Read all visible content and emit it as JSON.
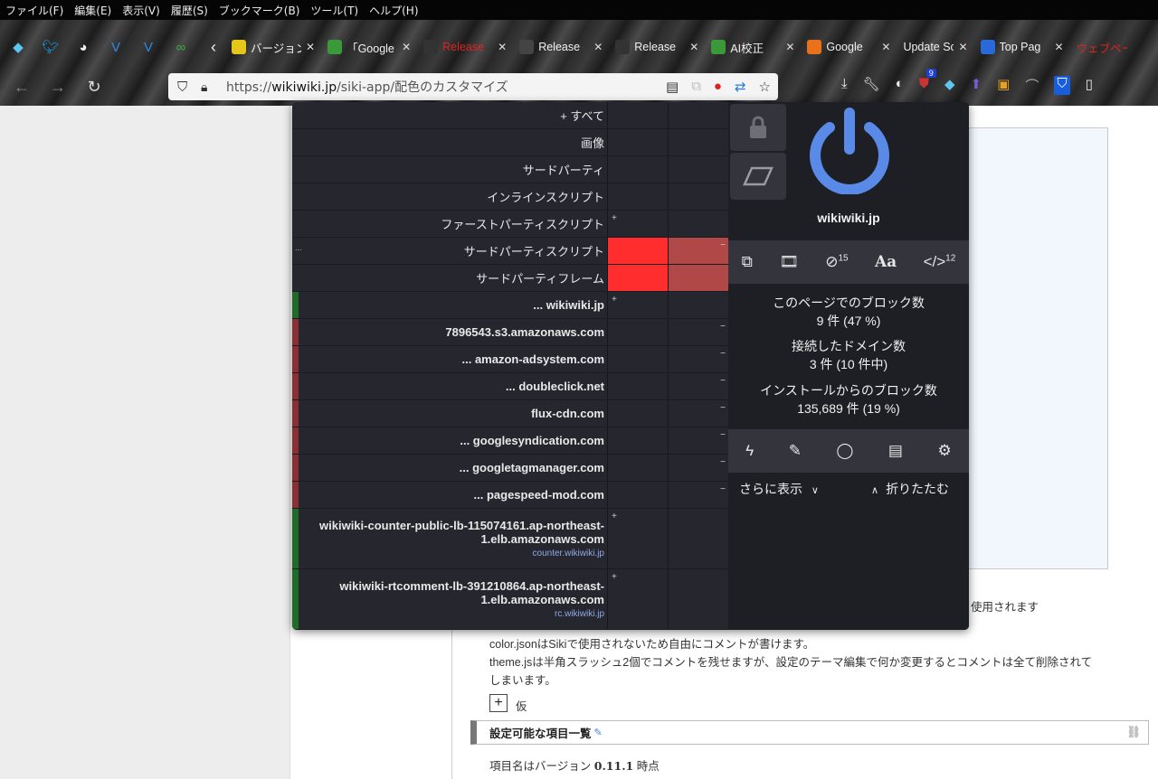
{
  "menubar": [
    "ファイル(F)",
    "編集(E)",
    "表示(V)",
    "履歴(S)",
    "ブックマーク(B)",
    "ツール(T)",
    "ヘルプ(H)"
  ],
  "pinned_icons": [
    "gem-icon",
    "twitter-icon",
    "compass-icon",
    "v-icon",
    "v-icon",
    "link-icon"
  ],
  "tabs": [
    {
      "label": "バージョン",
      "icon_color": "#e6c619",
      "icon": "tab-icon-star"
    },
    {
      "label": "「Google",
      "icon_color": "#3a9a3a",
      "icon": "tab-icon-link"
    },
    {
      "label": "Release",
      "icon_color": "#333333",
      "icon": "github-icon",
      "text_color": "#d22"
    },
    {
      "label": "Release",
      "icon_color": "#444444",
      "icon": "dot-icon"
    },
    {
      "label": "Release",
      "icon_color": "#333333",
      "icon": "github-icon"
    },
    {
      "label": "AI校正",
      "icon_color": "#3a9a3a",
      "icon": "tab-icon-link"
    },
    {
      "label": "Google",
      "icon_color": "#e8711c",
      "icon": "blogger-icon"
    },
    {
      "label": "Update Scar",
      "icon_color": "",
      "icon": ""
    },
    {
      "label": "Top Pag",
      "icon_color": "#2a6ad8",
      "icon": "edge-icon"
    },
    {
      "label": "ウェブページ",
      "icon_color": "",
      "icon": "",
      "text_color": "#d22"
    }
  ],
  "url": {
    "prefix": "https://",
    "host": "wikiwiki.jp",
    "path": "/siki-app/配色のカスタマイズ"
  },
  "ublock_badge": "9",
  "popup": {
    "rows": [
      {
        "name": "+ すべて",
        "bold": false,
        "c1": "",
        "c2": "",
        "c1_color": "",
        "c2_color": "",
        "strip": ""
      },
      {
        "name": "画像",
        "bold": false,
        "c1": "",
        "c2": "",
        "c1_color": "",
        "c2_color": "",
        "strip": ""
      },
      {
        "name": "サードパーティ",
        "bold": false,
        "c1": "",
        "c2": "",
        "c1_color": "",
        "c2_color": "",
        "strip": ""
      },
      {
        "name": "インラインスクリプト",
        "bold": false,
        "c1": "",
        "c2": "",
        "c1_color": "",
        "c2_color": "",
        "strip": ""
      },
      {
        "name": "ファーストパーティスクリプト",
        "bold": false,
        "c1": "+",
        "c2": "",
        "c1_color": "",
        "c2_color": "",
        "strip": ""
      },
      {
        "name": "サードパーティスクリプト",
        "bold": false,
        "c1": "",
        "c2": "−",
        "c1_color": "#ff2d2d",
        "c2_color": "#b04848",
        "strip": "",
        "dots": "..."
      },
      {
        "name": "サードパーティフレーム",
        "bold": false,
        "c1": "",
        "c2": "",
        "c1_color": "#ff2d2d",
        "c2_color": "#b04848",
        "strip": ""
      },
      {
        "name": "... wikiwiki.jp",
        "bold": true,
        "c1": "+",
        "c2": "",
        "c1_color": "",
        "c2_color": "",
        "strip": "#1f6b27"
      },
      {
        "name": "7896543.s3.amazonaws.com",
        "bold": true,
        "c1": "",
        "c2": "−",
        "c1_color": "",
        "c2_color": "",
        "strip": "#8a3035"
      },
      {
        "name": "... amazon-adsystem.com",
        "bold": true,
        "c1": "",
        "c2": "−",
        "c1_color": "",
        "c2_color": "",
        "strip": "#8a3035"
      },
      {
        "name": "... doubleclick.net",
        "bold": true,
        "c1": "",
        "c2": "−",
        "c1_color": "",
        "c2_color": "",
        "strip": "#8a3035"
      },
      {
        "name": "flux-cdn.com",
        "bold": true,
        "c1": "",
        "c2": "−",
        "c1_color": "",
        "c2_color": "",
        "strip": "#8a3035"
      },
      {
        "name": "... googlesyndication.com",
        "bold": true,
        "c1": "",
        "c2": "−",
        "c1_color": "",
        "c2_color": "",
        "strip": "#8a3035"
      },
      {
        "name": "... googletagmanager.com",
        "bold": true,
        "c1": "",
        "c2": "−",
        "c1_color": "",
        "c2_color": "",
        "strip": "#8a3035"
      },
      {
        "name": "... pagespeed-mod.com",
        "bold": true,
        "c1": "",
        "c2": "−",
        "c1_color": "",
        "c2_color": "",
        "strip": "#8a3035"
      }
    ],
    "lb_rows": [
      {
        "line1": "wikiwiki-counter-public-lb-115074161.ap-northeast-",
        "line2": "1.elb.amazonaws.com",
        "sub": "counter.wikiwiki.jp",
        "c1": "+",
        "strip": "#1f6b27"
      },
      {
        "line1": "wikiwiki-rtcomment-lb-391210864.ap-northeast-",
        "line2": "1.elb.amazonaws.com",
        "sub": "rc.wikiwiki.jp",
        "c1": "+",
        "strip": "#1f6b27"
      }
    ],
    "hostname": "wikiwiki.jp",
    "tool_counts": {
      "cosmetic": "15",
      "script": "12"
    },
    "tool_font_label": "Aa",
    "stats": [
      {
        "label": "このページでのブロック数",
        "value": "9 件 (47 %)"
      },
      {
        "label": "接続したドメイン数",
        "value": "3 件 (10 件中)"
      },
      {
        "label": "インストールからのブロック数",
        "value": "135,689 件 (19 %)"
      }
    ],
    "more_label": "さらに表示",
    "less_label": "折りたたむ",
    "accent": "#5a8ae8"
  },
  "page": {
    "line_used": "使用されます",
    "line1": "color.jsonはSikiで使用されないため自由にコメントが書けます。",
    "line2": "theme.jsは半角スラッシュ2個でコメントを残せますが、設定のテーマ編集で何か変更するとコメントは全て削除されて",
    "line3": "しまいます。",
    "kari": "仮",
    "section_title": "設定可能な項目一覧",
    "version_prefix": "項目名はバージョン",
    "version": "0.11.1",
    "version_suffix": "時点"
  }
}
